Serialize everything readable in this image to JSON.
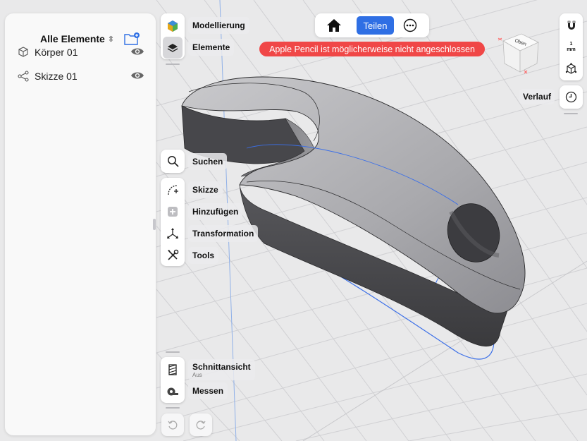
{
  "panel": {
    "title": "Alle Elemente",
    "items": [
      {
        "label": "Körper 01",
        "icon": "body-cube-icon"
      },
      {
        "label": "Skizze 01",
        "icon": "sketch-nodes-icon"
      }
    ]
  },
  "toolbar": {
    "modeling": "Modellierung",
    "elements": "Elemente",
    "search": "Suchen",
    "sketch": "Skizze",
    "add": "Hinzufügen",
    "transform": "Transformation",
    "tools": "Tools",
    "section_view": "Schnittansicht",
    "section_view_state": "Aus",
    "measure": "Messen"
  },
  "topbar": {
    "share_label": "Teilen",
    "warning": "Apple Pencil ist möglicherweise nicht angeschlossen"
  },
  "right": {
    "unit_top": "1",
    "unit_bottom": "mm",
    "history_label": "Verlauf",
    "viewcube_face": "Oben"
  },
  "colors": {
    "accent": "#2f6fe4",
    "warning": "#f04747",
    "sketch_line": "#3b6fe8"
  }
}
